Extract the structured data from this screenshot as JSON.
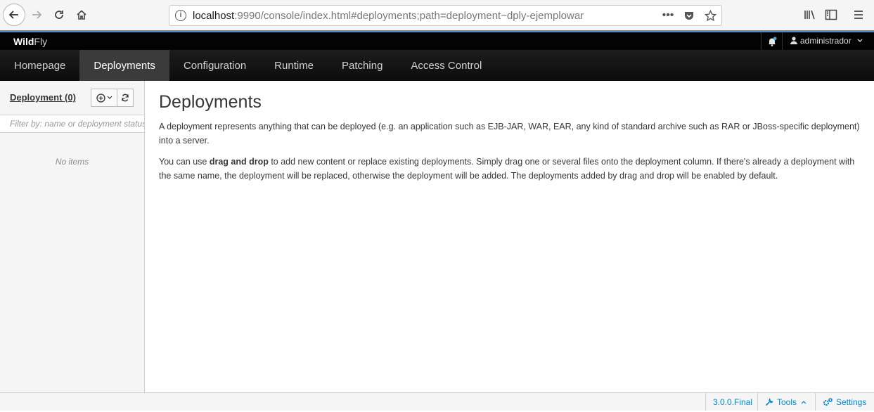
{
  "browser": {
    "url_host": "localhost",
    "url_rest": ":9990/console/index.html#deployments;path=deployment~dply-ejemplowar"
  },
  "header": {
    "brand_bold": "Wild",
    "brand_light": "Fly",
    "user": "administrador"
  },
  "nav": {
    "items": [
      "Homepage",
      "Deployments",
      "Configuration",
      "Runtime",
      "Patching",
      "Access Control"
    ],
    "active": "Deployments"
  },
  "sidebar": {
    "title": "Deployment (0)",
    "filter_placeholder": "Filter by: name or deployment status",
    "empty": "No items"
  },
  "content": {
    "title": "Deployments",
    "para1": "A deployment represents anything that can be deployed (e.g. an application such as EJB-JAR, WAR, EAR, any kind of standard archive such as RAR or JBoss-specific deployment) into a server.",
    "para2_before": "You can use ",
    "para2_bold": "drag and drop",
    "para2_after": " to add new content or replace existing deployments. Simply drag one or several files onto the deployment column. If there's already a deployment with the same name, the deployment will be replaced, otherwise the deployment will be added. The deployments added by drag and drop will be enabled by default."
  },
  "footer": {
    "version": "3.0.0.Final",
    "tools": "Tools",
    "settings": "Settings"
  },
  "colors": {
    "accent": "#4d90c7",
    "link": "#0088ce",
    "notify_dot": "#39a5dc"
  }
}
